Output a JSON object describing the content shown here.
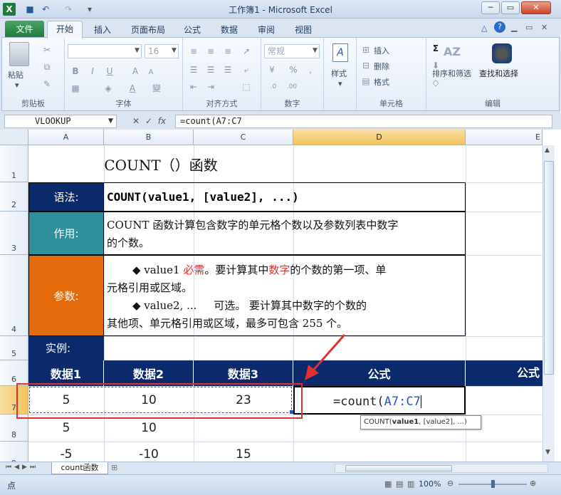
{
  "window": {
    "title": "工作簿1 - Microsoft Excel",
    "minimize": "─",
    "restore": "▭",
    "close": "✕"
  },
  "tabs": [
    "文件",
    "开始",
    "插入",
    "页面布局",
    "公式",
    "数据",
    "审阅",
    "视图"
  ],
  "ribbon": {
    "clipboard": {
      "paste": "粘贴",
      "label": "剪贴板"
    },
    "font": {
      "size": "16",
      "label": "字体",
      "bold": "B",
      "italic": "I",
      "underline": "U",
      "big_a": "A",
      "small_a": "A"
    },
    "alignment": {
      "label": "对齐方式"
    },
    "number": {
      "format": "常规",
      "label": "数字",
      "percent": "%",
      "comma": ","
    },
    "styles": {
      "label": "样式"
    },
    "cells": {
      "insert": "插入",
      "delete": "删除",
      "format": "格式",
      "label": "单元格"
    },
    "editing": {
      "sort": "排序和筛选",
      "find": "查找和选择",
      "label": "编辑",
      "sigma": "Σ"
    }
  },
  "formula_bar": {
    "name_box": "VLOOKUP",
    "fx": "fx",
    "formula": "=count(A7:C7"
  },
  "columns": [
    "A",
    "B",
    "C",
    "D",
    "E"
  ],
  "rows": [
    "1",
    "2",
    "3",
    "4",
    "5",
    "6",
    "7",
    "8",
    "9"
  ],
  "sheet": {
    "title": "COUNT（）函数",
    "syntax_label": "语法:",
    "syntax_value": "COUNT(value1, [value2], ...)",
    "purpose_label": "作用:",
    "purpose_line1": "COUNT 函数计算包含数字的单元格个数以及参数列表中数字",
    "purpose_line2": "的个数。",
    "params_label": "参数:",
    "p1_a": "◆ value1 ",
    "p1_b": "必需",
    "p1_c": "。要计算其中",
    "p1_d": "数字",
    "p1_e": "的个数的第一项、单",
    "p1_line2": "元格引用或区域。",
    "p2_line1": "◆ value2, ...     可选。 要计算其中数字的个数的",
    "p2_line2": "其他项、单元格引用或区域，最多可包含 255 个。",
    "example_label": "实例:",
    "headers": [
      "数据1",
      "数据2",
      "数据3",
      "公式",
      "公式"
    ],
    "r7": [
      "5",
      "10",
      "23"
    ],
    "r8": [
      "5",
      "10",
      ""
    ],
    "r9": [
      "-5",
      "-10",
      "15"
    ],
    "formula_prefix": "=count(",
    "formula_ref": "A7:C7",
    "tooltip_fn": "COUNT(",
    "tooltip_arg1": "value1",
    "tooltip_rest": ", [value2], ...)"
  },
  "sheet_tab": "count函数",
  "status": {
    "mode": "点",
    "zoom": "100%"
  },
  "colors": {
    "navy": "#0b2a6c",
    "teal": "#2f8f9a",
    "orange": "#e46b0c",
    "red_annotation": "#e03030",
    "ref_blue": "#2255cc"
  }
}
